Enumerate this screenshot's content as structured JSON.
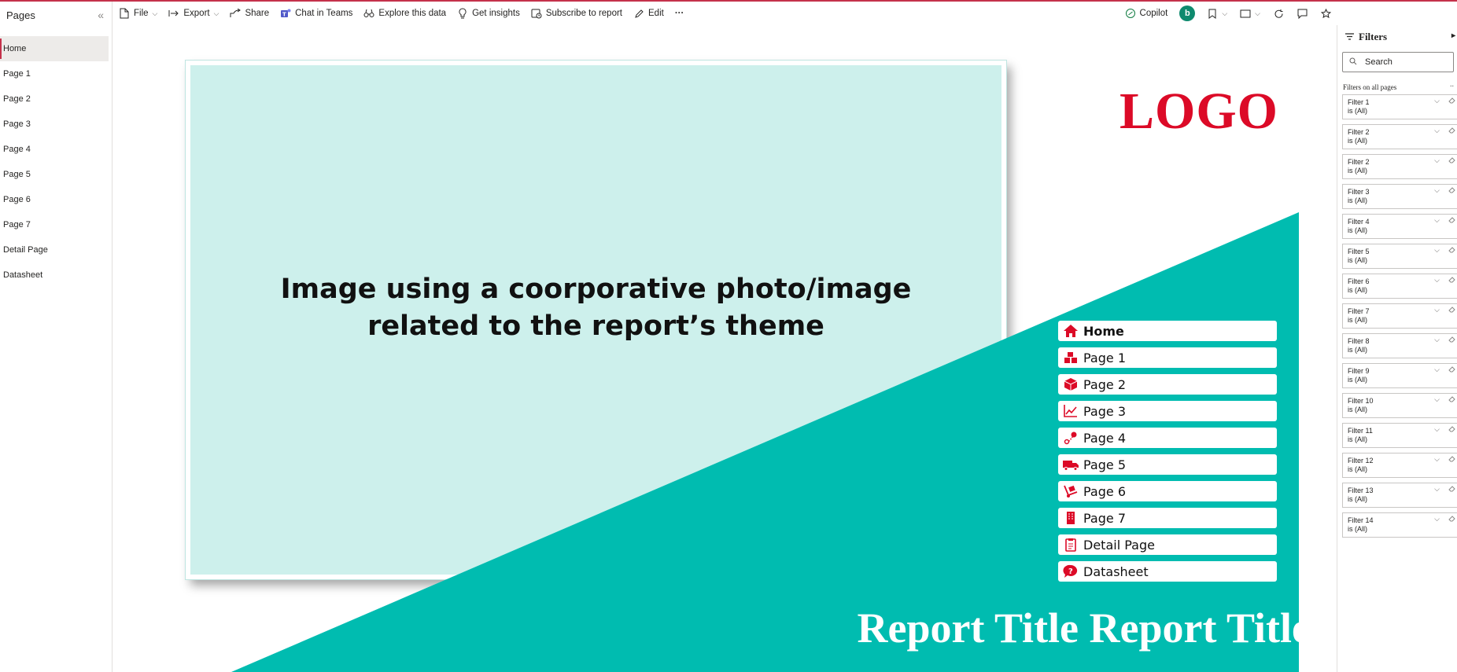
{
  "pages_pane": {
    "title": "Pages",
    "collapse_glyph": "«",
    "items": [
      {
        "label": "Home",
        "active": true
      },
      {
        "label": "Page 1"
      },
      {
        "label": "Page 2"
      },
      {
        "label": "Page 3"
      },
      {
        "label": "Page 4"
      },
      {
        "label": "Page 5"
      },
      {
        "label": "Page 6"
      },
      {
        "label": "Page 7"
      },
      {
        "label": "Detail Page"
      },
      {
        "label": "Datasheet"
      }
    ]
  },
  "toolbar": {
    "file": "File",
    "export": "Export",
    "share": "Share",
    "chat_in_teams": "Chat in Teams",
    "explore": "Explore this data",
    "insights": "Get insights",
    "subscribe": "Subscribe to report",
    "edit": "Edit",
    "more": "···",
    "copilot": "Copilot",
    "avatar_initial": "b"
  },
  "report": {
    "image_placeholder_line1": "Image using a coorporative photo/image",
    "image_placeholder_line2": "related to the report’s theme",
    "logo": "LOGO",
    "title": "Report Title Report Title",
    "nav_buttons": [
      {
        "label": "Home",
        "icon": "home-icon"
      },
      {
        "label": "Page 1",
        "icon": "boxes-icon"
      },
      {
        "label": "Page 2",
        "icon": "cube-icon"
      },
      {
        "label": "Page 3",
        "icon": "line-chart-icon"
      },
      {
        "label": "Page 4",
        "icon": "route-icon"
      },
      {
        "label": "Page 5",
        "icon": "truck-icon"
      },
      {
        "label": "Page 6",
        "icon": "hand-truck-icon"
      },
      {
        "label": "Page 7",
        "icon": "building-icon"
      },
      {
        "label": "Detail Page",
        "icon": "clipboard-icon"
      },
      {
        "label": "Datasheet",
        "icon": "question-bubble-icon"
      }
    ],
    "colors": {
      "teal": "#00bcb0",
      "image_fill": "#cdf0ec",
      "accent_red": "#dc0a27"
    }
  },
  "filters_pane": {
    "title": "Filters",
    "search_placeholder": "Search",
    "section": "Filters on all pages",
    "cards": [
      {
        "name": "Filter 1",
        "value": "is (All)"
      },
      {
        "name": "Filter 2",
        "value": "is (All)"
      },
      {
        "name": "Filter 2",
        "value": "is (All)"
      },
      {
        "name": "Filter 3",
        "value": "is (All)"
      },
      {
        "name": "Filter 4",
        "value": "is (All)"
      },
      {
        "name": "Filter 5",
        "value": "is (All)"
      },
      {
        "name": "Filter 6",
        "value": "is (All)"
      },
      {
        "name": "Filter 7",
        "value": "is (All)"
      },
      {
        "name": "Filter 8",
        "value": "is (All)"
      },
      {
        "name": "Filter 9",
        "value": "is (All)"
      },
      {
        "name": "Filter 10",
        "value": "is (All)"
      },
      {
        "name": "Filter 11",
        "value": "is (All)"
      },
      {
        "name": "Filter 12",
        "value": "is (All)"
      },
      {
        "name": "Filter 13",
        "value": "is (All)"
      },
      {
        "name": "Filter 14",
        "value": "is (All)"
      }
    ]
  }
}
